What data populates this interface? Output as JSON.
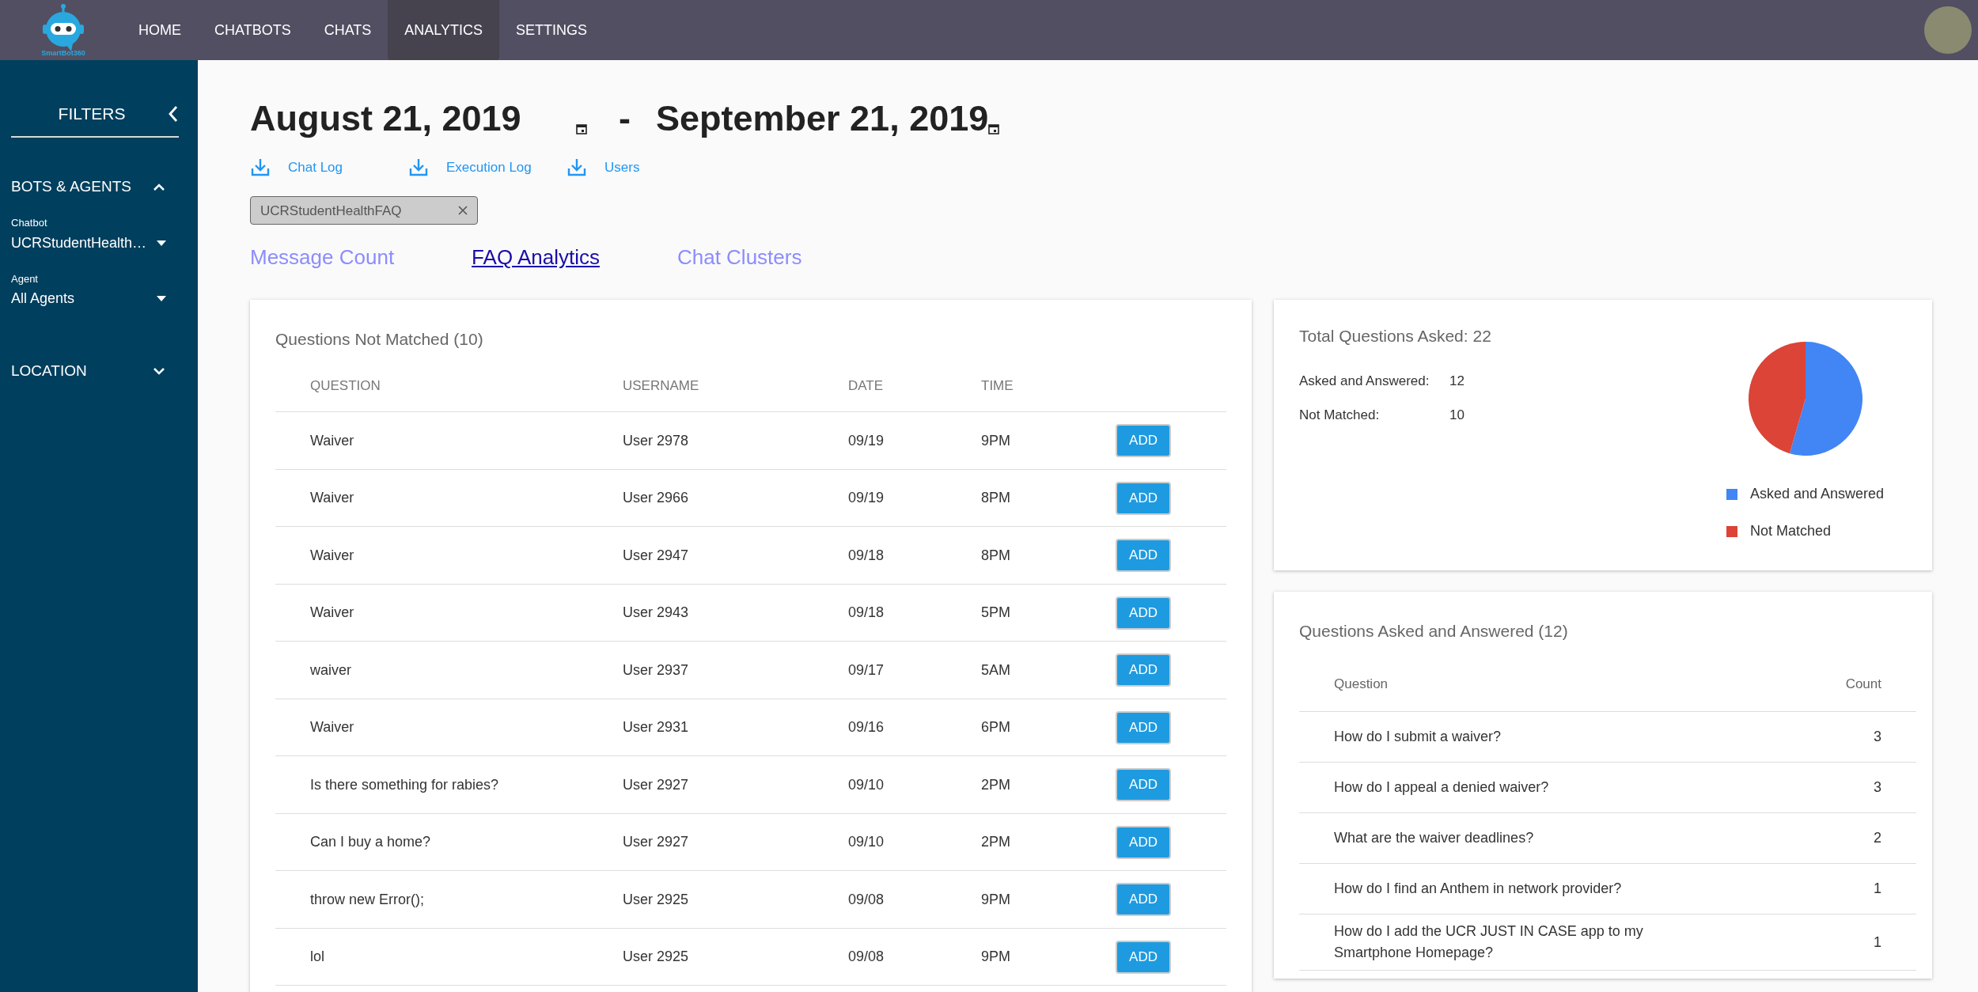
{
  "logo": {
    "text": "SmartBot360"
  },
  "nav": [
    {
      "label": "HOME",
      "selected": false
    },
    {
      "label": "CHATBOTS",
      "selected": false
    },
    {
      "label": "CHATS",
      "selected": false
    },
    {
      "label": "ANALYTICS",
      "selected": true
    },
    {
      "label": "SETTINGS",
      "selected": false
    }
  ],
  "sidebar": {
    "title": "FILTERS",
    "sections": [
      {
        "title": "BOTS & AGENTS",
        "expanded": true,
        "fields": [
          {
            "label": "Chatbot",
            "value": "UCRStudentHealth…"
          },
          {
            "label": "Agent",
            "value": "All Agents"
          }
        ]
      },
      {
        "title": "LOCATION",
        "expanded": false
      }
    ]
  },
  "date_range": {
    "start": "August 21, 2019",
    "separator": "-",
    "end": "September 21, 2019"
  },
  "downloads": [
    "Chat Log",
    "Execution Log",
    "Users"
  ],
  "filter_chip": "UCRStudentHealthFAQ",
  "tabs": [
    {
      "label": "Message Count",
      "selected": false
    },
    {
      "label": "FAQ Analytics",
      "selected": true
    },
    {
      "label": "Chat Clusters",
      "selected": false
    }
  ],
  "not_matched": {
    "title": "Questions Not Matched (10)",
    "columns": [
      "QUESTION",
      "USERNAME",
      "DATE",
      "TIME"
    ],
    "rows": [
      {
        "question": "Waiver",
        "username": "User 2978",
        "date": "09/19",
        "time": "9PM",
        "button": "ADD"
      },
      {
        "question": "Waiver",
        "username": "User 2966",
        "date": "09/19",
        "time": "8PM",
        "button": "ADD"
      },
      {
        "question": "Waiver",
        "username": "User 2947",
        "date": "09/18",
        "time": "8PM",
        "button": "ADD"
      },
      {
        "question": "Waiver",
        "username": "User 2943",
        "date": "09/18",
        "time": "5PM",
        "button": "ADD"
      },
      {
        "question": "waiver",
        "username": "User 2937",
        "date": "09/17",
        "time": "5AM",
        "button": "ADD"
      },
      {
        "question": "Waiver",
        "username": "User 2931",
        "date": "09/16",
        "time": "6PM",
        "button": "ADD"
      },
      {
        "question": "Is there something for rabies?",
        "username": "User 2927",
        "date": "09/10",
        "time": "2PM",
        "button": "ADD"
      },
      {
        "question": "Can I buy a home?",
        "username": "User 2927",
        "date": "09/10",
        "time": "2PM",
        "button": "ADD"
      },
      {
        "question": "throw new Error();",
        "username": "User 2925",
        "date": "09/08",
        "time": "9PM",
        "button": "ADD"
      },
      {
        "question": "lol",
        "username": "User 2925",
        "date": "09/08",
        "time": "9PM",
        "button": "ADD"
      }
    ]
  },
  "summary": {
    "title": "Total Questions Asked: 22",
    "stats": [
      {
        "label": "Asked and Answered:",
        "value": "12"
      },
      {
        "label": "Not Matched:",
        "value": "10"
      }
    ],
    "chart_data": {
      "type": "pie",
      "categories": [
        "Asked and Answered",
        "Not Matched"
      ],
      "values": [
        54.5,
        45.5
      ],
      "colors": [
        "#4285f4",
        "#db4437"
      ],
      "legend": "bottom"
    }
  },
  "answered": {
    "title": "Questions Asked and Answered (12)",
    "columns": [
      "Question",
      "Count"
    ],
    "rows": [
      {
        "question": "How do I submit a waiver?",
        "count": "3"
      },
      {
        "question": "How do I appeal a denied waiver?",
        "count": "3"
      },
      {
        "question": "What are the waiver deadlines?",
        "count": "2"
      },
      {
        "question": "How do I find an Anthem in network provider?",
        "count": "1"
      },
      {
        "question": "How do I add the UCR JUST IN CASE app to my Smartphone Homepage?",
        "count": "1"
      }
    ]
  }
}
